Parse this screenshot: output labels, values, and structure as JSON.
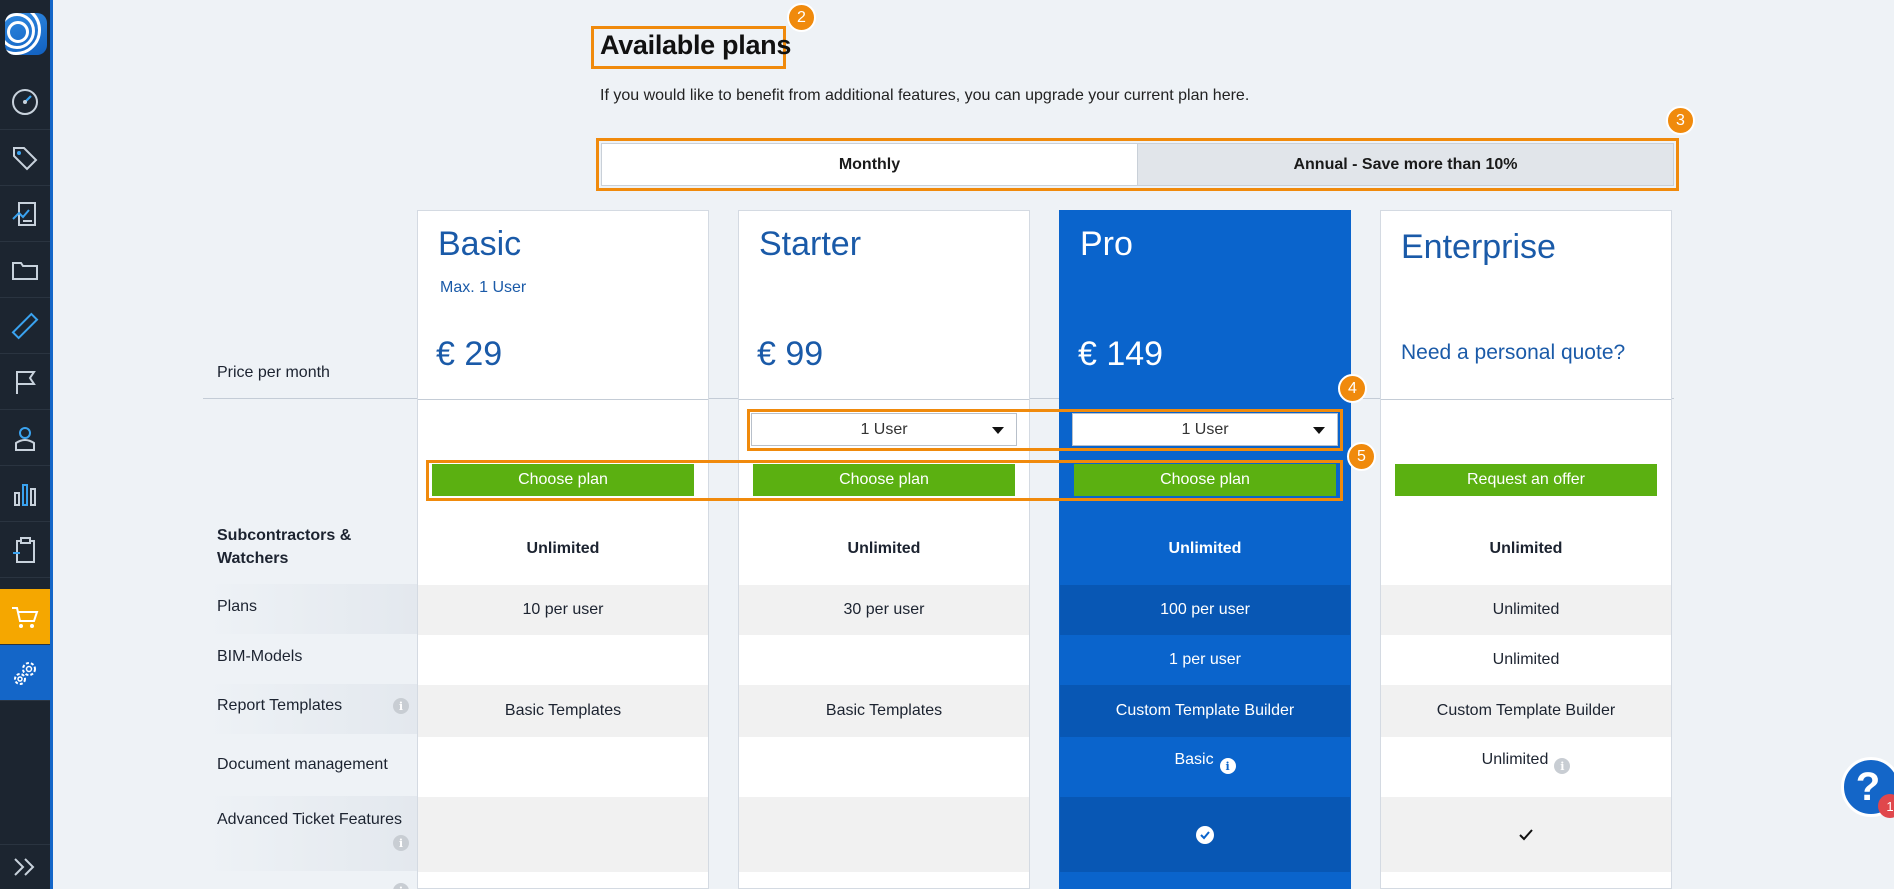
{
  "colors": {
    "accent": "#f08a0c",
    "brand_blue": "#1466c8",
    "pro_blue": "#0a64cc",
    "green": "#5bb011",
    "sidebar_bg": "#1c2530",
    "active_nav": "#f5a700"
  },
  "sidebar": {
    "items": [
      {
        "icon": "speedometer-icon"
      },
      {
        "icon": "tags-icon"
      },
      {
        "icon": "report-icon"
      },
      {
        "icon": "folder-icon"
      },
      {
        "icon": "ruler-icon"
      },
      {
        "icon": "flag-icon"
      },
      {
        "icon": "user-icon"
      },
      {
        "icon": "bar-chart-icon"
      },
      {
        "icon": "clipboard-icon"
      },
      {
        "icon": "shopping-cart-icon",
        "active": true
      },
      {
        "icon": "settings-icon"
      }
    ],
    "expand_icon": "double-chevron-right-icon"
  },
  "header": {
    "title": "Available plans",
    "subtitle": "If you would like to benefit from additional features, you can upgrade your current plan here."
  },
  "annotations": {
    "badge_title": "2",
    "badge_toggle": "3",
    "badge_users": "4",
    "badge_choose": "5"
  },
  "billing_toggle": {
    "monthly": "Monthly",
    "annual": "Annual - Save more than 10%",
    "selected": "Monthly"
  },
  "row_labels": {
    "price": "Price per month",
    "subcontractors": "Subcontractors & Watchers",
    "plans": "Plans",
    "bim": "BIM-Models",
    "report_templates": "Report Templates",
    "document_management": "Document management",
    "advanced_ticket": "Advanced Ticket Features"
  },
  "plans": {
    "basic": {
      "name": "Basic",
      "sub": "Max. 1 User",
      "price": "€ 29",
      "button": "Choose plan",
      "subcontractors": "Unlimited",
      "plans": "10 per user",
      "bim": "",
      "report_templates": "Basic Templates",
      "document_management": ""
    },
    "starter": {
      "name": "Starter",
      "price": "€ 99",
      "users": "1 User",
      "button": "Choose plan",
      "subcontractors": "Unlimited",
      "plans": "30 per user",
      "bim": "",
      "report_templates": "Basic Templates",
      "document_management": ""
    },
    "pro": {
      "name": "Pro",
      "price": "€ 149",
      "users": "1 User",
      "button": "Choose plan",
      "subcontractors": "Unlimited",
      "plans": "100 per user",
      "bim": "1 per user",
      "report_templates": "Custom Template Builder",
      "document_management": "Basic"
    },
    "enterprise": {
      "name": "Enterprise",
      "quote": "Need a personal quote?",
      "button": "Request an offer",
      "subcontractors": "Unlimited",
      "plans": "Unlimited",
      "bim": "Unlimited",
      "report_templates": "Custom Template Builder",
      "document_management": "Unlimited"
    }
  },
  "help": {
    "label": "?",
    "count": "1"
  }
}
